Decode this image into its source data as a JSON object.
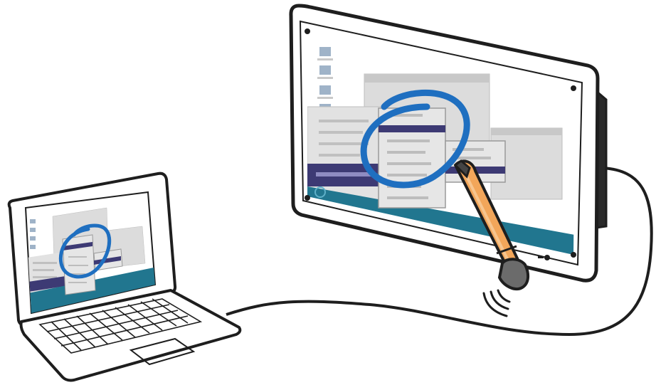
{
  "illustration": {
    "devices": [
      "laptop",
      "interactive-display",
      "digital-pen"
    ],
    "icons": [
      "laptop-icon",
      "display-icon",
      "pen-icon",
      "cable-icon",
      "sound-waves-icon",
      "power-button-icon"
    ]
  },
  "colors": {
    "outline": "#1e1e1e",
    "bezel": "#ffffff",
    "desktop": "#ffffff",
    "window_gray": "#d9d9d9",
    "window_gray_dark": "#c4c4c4",
    "menu_bar_purple": "#3d3a74",
    "taskbar_teal": "#21768f",
    "annotation_blue": "#1f6fc0",
    "pen_orange": "#f2a65a",
    "pen_tip_gray": "#6b6b6b"
  }
}
